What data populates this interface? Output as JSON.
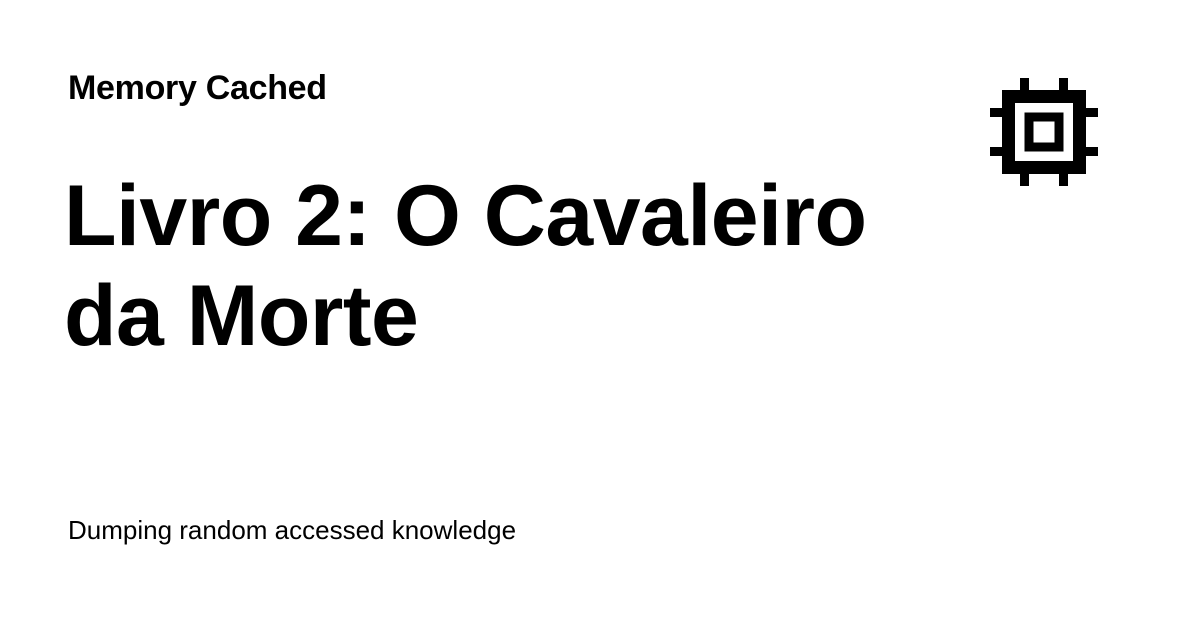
{
  "site": {
    "name": "Memory Cached",
    "tagline": "Dumping random accessed knowledge",
    "logo_icon": "cpu-chip-icon"
  },
  "post": {
    "title": "Livro 2: O Cavaleiro da Morte"
  },
  "colors": {
    "background": "#ffffff",
    "text": "#000000"
  }
}
